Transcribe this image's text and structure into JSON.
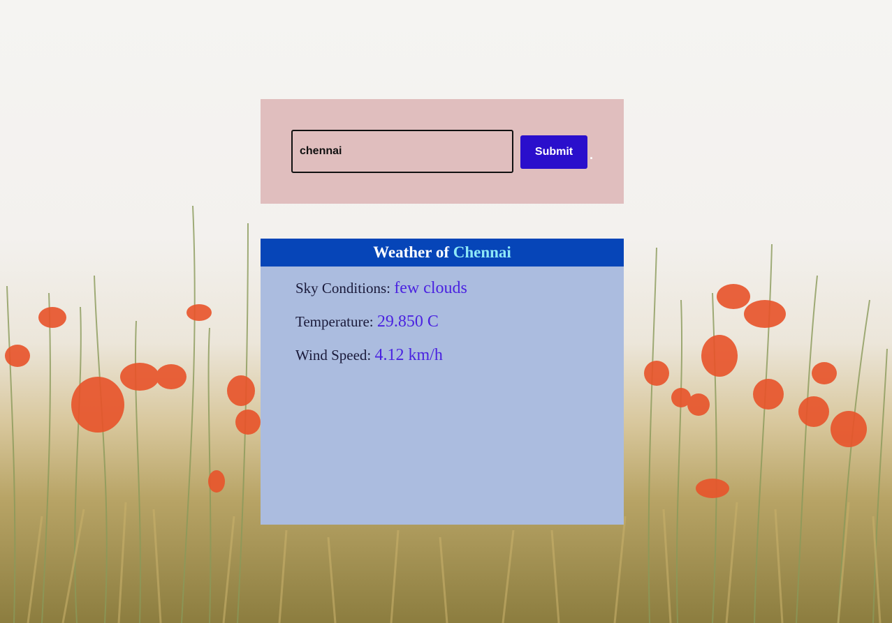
{
  "search": {
    "input_value": "chennai",
    "submit_label": "Submit",
    "trailing_mark": "."
  },
  "weather": {
    "header_prefix": "Weather of",
    "city": "Chennai",
    "sky_label": "Sky Conditions:",
    "sky_value": "few clouds",
    "temp_label": "Temperature:",
    "temp_value": "29.850 C",
    "wind_label": "Wind Speed:",
    "wind_value": "4.12 km/h"
  },
  "colors": {
    "search_panel_bg": "#e0bebe",
    "submit_bg": "#2a0fcc",
    "header_bg": "#0645b8",
    "city_color": "#8ee8f6",
    "weather_panel_bg": "#abbcdf",
    "value_color": "#4a22e0"
  },
  "background": {
    "icon": "poppy-field-photo"
  }
}
